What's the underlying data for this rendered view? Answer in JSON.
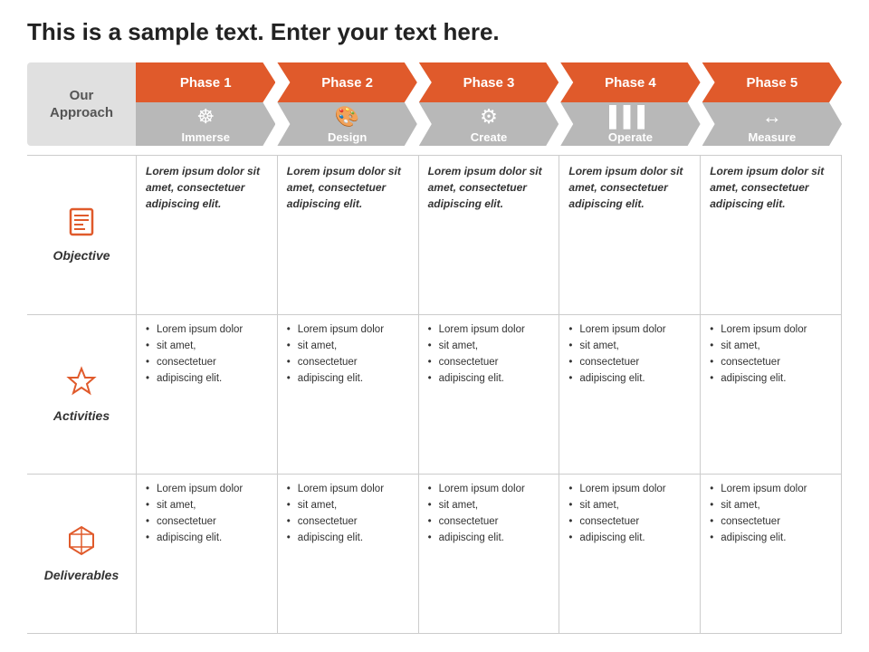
{
  "title": "This is a sample text. Enter your text here.",
  "approach_label": "Our\nApproach",
  "phases": [
    {
      "id": 1,
      "label": "Phase 1",
      "icon": "⊙",
      "sublabel": "Immerse",
      "color": "#e05a2b"
    },
    {
      "id": 2,
      "label": "Phase 2",
      "icon": "🎨",
      "sublabel": "Design",
      "color": "#e05a2b"
    },
    {
      "id": 3,
      "label": "Phase 3",
      "icon": "⚙",
      "sublabel": "Create",
      "color": "#e05a2b"
    },
    {
      "id": 4,
      "label": "Phase 4",
      "icon": "📊",
      "sublabel": "Operate",
      "color": "#e05a2b"
    },
    {
      "id": 5,
      "label": "Phase 5",
      "icon": "↔",
      "sublabel": "Measure",
      "color": "#e05a2b"
    }
  ],
  "rows": [
    {
      "id": "objective",
      "label": "Objective",
      "icon": "📋",
      "type": "text",
      "cells": [
        "Lorem ipsum dolor sit amet, consectetuer adipiscing elit.",
        "Lorem ipsum dolor sit amet, consectetuer adipiscing elit.",
        "Lorem ipsum dolor sit amet, consectetuer adipiscing elit.",
        "Lorem ipsum dolor sit amet, consectetuer adipiscing elit.",
        "Lorem ipsum dolor sit amet, consectetuer adipiscing elit."
      ]
    },
    {
      "id": "activities",
      "label": "Activities",
      "icon": "✦",
      "type": "bullets",
      "cells": [
        [
          "Lorem ipsum dolor",
          "sit amet,",
          "consectetuer",
          "adipiscing elit."
        ],
        [
          "Lorem ipsum dolor",
          "sit amet,",
          "consectetuer",
          "adipiscing elit."
        ],
        [
          "Lorem ipsum dolor",
          "sit amet,",
          "consectetuer",
          "adipiscing elit."
        ],
        [
          "Lorem ipsum dolor",
          "sit amet,",
          "consectetuer",
          "adipiscing elit."
        ],
        [
          "Lorem ipsum dolor",
          "sit amet,",
          "consectetuer",
          "adipiscing elit."
        ]
      ]
    },
    {
      "id": "deliverables",
      "label": "Deliverables",
      "icon": "⏳",
      "type": "bullets",
      "cells": [
        [
          "Lorem ipsum dolor",
          "sit amet,",
          "consectetuer",
          "adipiscing elit."
        ],
        [
          "Lorem ipsum dolor",
          "sit amet,",
          "consectetuer",
          "adipiscing elit."
        ],
        [
          "Lorem ipsum dolor",
          "sit amet,",
          "consectetuer",
          "adipiscing elit."
        ],
        [
          "Lorem ipsum dolor",
          "sit amet,",
          "consectetuer",
          "adipiscing elit."
        ],
        [
          "Lorem ipsum dolor",
          "sit amet,",
          "consectetuer",
          "adipiscing elit."
        ]
      ]
    }
  ],
  "colors": {
    "orange": "#e05a2b",
    "gray": "#b0b0b0",
    "dark_gray": "#888888"
  }
}
